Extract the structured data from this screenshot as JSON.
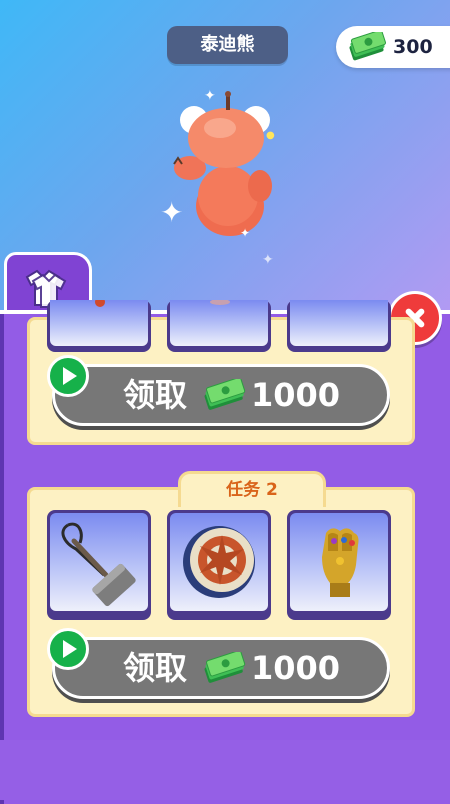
{
  "header": {
    "character_name": "泰迪熊",
    "money": "300",
    "money_icon": "cash-stack-icon"
  },
  "tab": {
    "icon": "outfits-icon"
  },
  "close": {
    "icon": "close-icon"
  },
  "tasks": [
    {
      "label": "",
      "claim_label": "领取",
      "price": "1000",
      "items": [
        "item-slot",
        "item-slot",
        "item-slot"
      ]
    },
    {
      "label": "任务 2",
      "claim_label": "领取",
      "price": "1000",
      "items": [
        "hammer-icon",
        "shield-icon",
        "gauntlet-icon"
      ]
    }
  ],
  "colors": {
    "accent_purple": "#8043d3",
    "card_bg": "#fdf1c3",
    "task_label": "#d9641a",
    "claim_button": "#777777",
    "play_badge": "#16b14a",
    "close_button": "#ef3b3b"
  }
}
